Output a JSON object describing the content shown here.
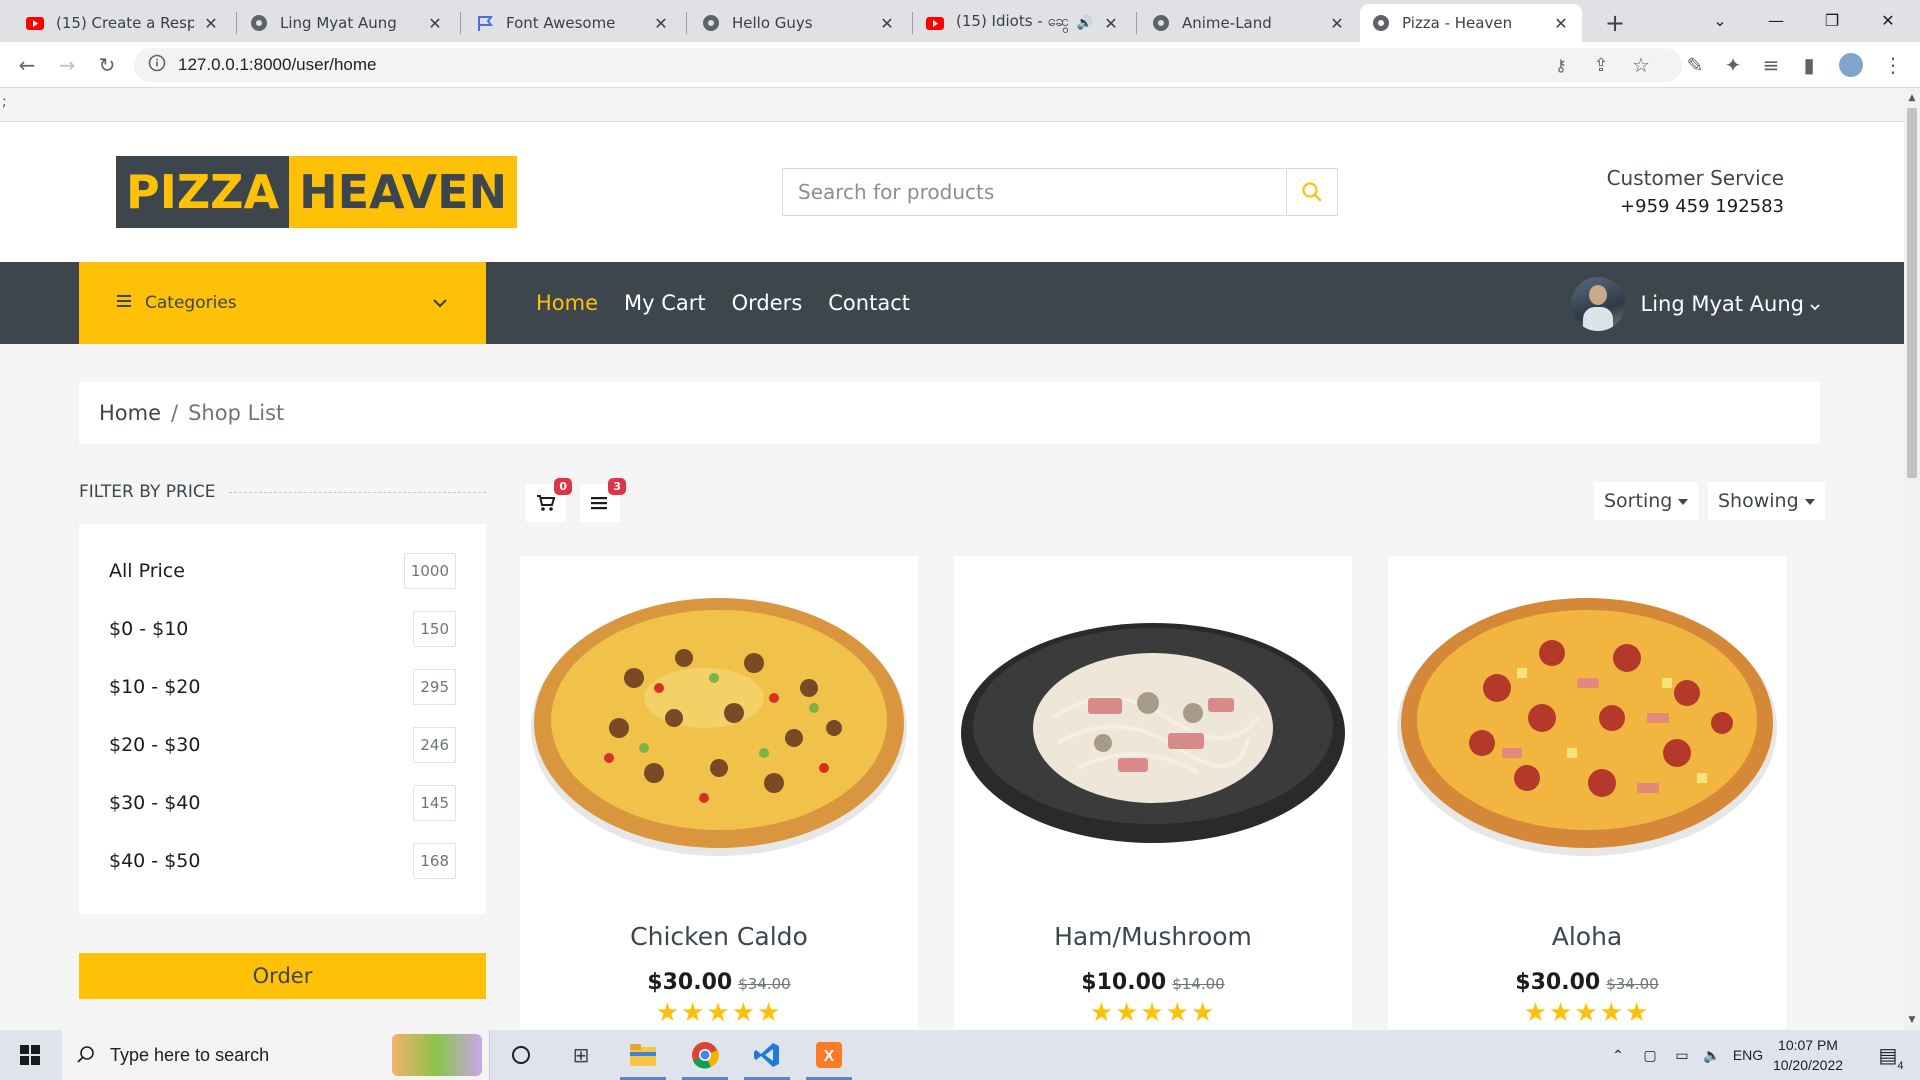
{
  "browser": {
    "tabs": [
      {
        "title": "(15) Create a Respons",
        "icon": "youtube-icon"
      },
      {
        "title": "Ling Myat Aung",
        "icon": "globe-icon"
      },
      {
        "title": "Font Awesome",
        "icon": "flag-icon"
      },
      {
        "title": "Hello Guys",
        "icon": "globe-icon"
      },
      {
        "title": "(15) Idiots - ဆွေး",
        "icon": "youtube-icon"
      },
      {
        "title": "Anime-Land",
        "icon": "globe-icon"
      },
      {
        "title": "Pizza - Heaven",
        "icon": "globe-icon"
      }
    ],
    "url": "127.0.0.1:8000/user/home"
  },
  "stray_text": ";",
  "site": {
    "logo_part1": "PIZZA",
    "logo_part2": "HEAVEN",
    "search_placeholder": "Search for products",
    "customer_service_label": "Customer Service",
    "customer_service_phone": "+959 459 192583",
    "categories_label": "Categories",
    "nav": [
      "Home",
      "My Cart",
      "Orders",
      "Contact"
    ],
    "user_name": "Ling Myat Aung"
  },
  "breadcrumb": {
    "home": "Home",
    "separator": "/",
    "current": "Shop List"
  },
  "filter": {
    "title": "FILTER BY PRICE",
    "items": [
      {
        "label": "All Price",
        "count": "1000"
      },
      {
        "label": "$0 - $10",
        "count": "150"
      },
      {
        "label": "$10 - $20",
        "count": "295"
      },
      {
        "label": "$20 - $30",
        "count": "246"
      },
      {
        "label": "$30 - $40",
        "count": "145"
      },
      {
        "label": "$40 - $50",
        "count": "168"
      }
    ],
    "order_label": "Order"
  },
  "shop_tools": {
    "cart_count": "0",
    "list_count": "3",
    "sorting_label": "Sorting",
    "showing_label": "Showing"
  },
  "products": [
    {
      "name": "Chicken Caldo",
      "price": "$30.00",
      "old_price": "$34.00",
      "stars": "★★★★★"
    },
    {
      "name": "Ham/Mushroom",
      "price": "$10.00",
      "old_price": "$14.00",
      "stars": "★★★★★"
    },
    {
      "name": "Aloha",
      "price": "$30.00",
      "old_price": "$34.00",
      "stars": "★★★★★"
    }
  ],
  "taskbar": {
    "search_placeholder": "Type here to search",
    "language": "ENG",
    "time": "10:07 PM",
    "date": "10/20/2022",
    "notification_count": "4"
  },
  "colors": {
    "accent": "#ffc107",
    "dark": "#3d464d",
    "badge": "#dc3545"
  }
}
